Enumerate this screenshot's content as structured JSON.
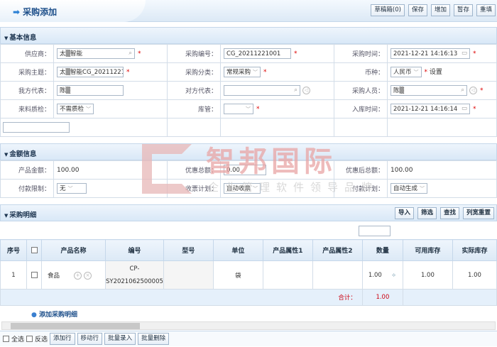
{
  "header": {
    "title": "采购添加",
    "buttons": [
      "草稿箱(0)",
      "保存",
      "增加",
      "暂存",
      "重填"
    ]
  },
  "basic": {
    "title": "基本信息",
    "supplier_label": "供应商：",
    "supplier": "太▒智能",
    "code_label": "采购编号：",
    "code": "CG_20211221001",
    "time_label": "采购时间：",
    "time": "2021-12-21 14:16:13",
    "subject_label": "采购主题：",
    "subject": "太▒智能CG_2021122100",
    "category_label": "采购分类：",
    "category": "常规采购",
    "currency_label": "币种：",
    "currency": "人民币",
    "currency_settings": "设置",
    "our_rep_label": "我方代表：",
    "our_rep": "陈▒",
    "their_rep_label": "对方代表：",
    "their_rep": "",
    "buyer_label": "采购人员：",
    "buyer": "陈▒",
    "qc_label": "来料质检：",
    "qc": "不需质检",
    "keeper_label": "库管：",
    "keeper": "",
    "instock_label": "入库时间：",
    "instock": "2021-12-21 14:16:14"
  },
  "amount": {
    "title": "金额信息",
    "product_amount_label": "产品金额：",
    "product_amount": "100.00",
    "discount_label": "优惠总额：",
    "discount": "0.00",
    "after_label": "优惠后总额：",
    "after": "100.00",
    "pay_limit_label": "付款限制：",
    "pay_limit": "无",
    "invoice_plan_label": "收票计划：",
    "invoice_plan": "自动收票",
    "pay_plan_label": "付款计划：",
    "pay_plan": "自动生成"
  },
  "detail": {
    "title": "采购明细",
    "buttons": [
      "导入",
      "筛选",
      "查找",
      "列宽重置"
    ],
    "columns": [
      "序号",
      "",
      "产品名称",
      "编号",
      "型号",
      "单位",
      "产品属性1",
      "产品属性2",
      "数量",
      "可用库存",
      "实际库存"
    ],
    "rows": [
      {
        "no": "1",
        "name": "食品",
        "code1": "CP-",
        "code2": "SY2021062500005",
        "model": "",
        "unit": "袋",
        "attr1": "",
        "attr2": "",
        "qty": "1.00",
        "avail": "1.00",
        "actual": "1.00"
      }
    ],
    "total_label": "合计：",
    "total_qty": "1.00",
    "add_link": "添加采购明细",
    "footer": {
      "select_all": "全选",
      "invert": "反选",
      "buttons": [
        "添加行",
        "移动行",
        "批量录入",
        "批量删除"
      ]
    }
  },
  "watermark": {
    "brand": "智邦国际",
    "slogan": "企业管理软件领导品牌"
  },
  "colors": {
    "required": "#dd0000",
    "header_bg": "#dce9f6",
    "total": "#cc1111"
  }
}
